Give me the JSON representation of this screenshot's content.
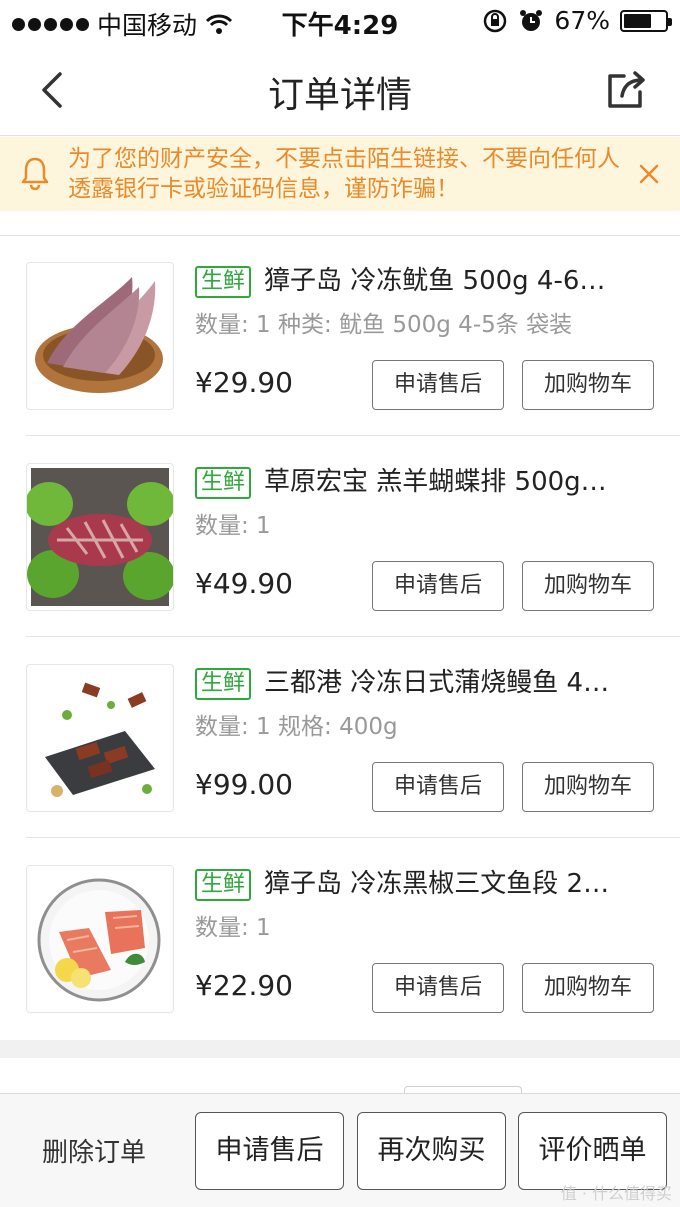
{
  "status_bar": {
    "carrier": "中国移动",
    "time": "下午4:29",
    "battery_text": "67%",
    "battery_level": 0.67
  },
  "nav": {
    "title": "订单详情",
    "back_icon": "chevron-left-icon",
    "share_icon": "share-icon"
  },
  "notice": {
    "text": "为了您的财产安全，不要点击陌生链接、不要向任何人透露银行卡或验证码信息，谨防诈骗！",
    "icon": "bell-icon",
    "close_icon": "close-icon",
    "color": "#e98a2b"
  },
  "items": [
    {
      "tag": "生鲜",
      "title": "獐子岛 冷冻鱿鱼 500g 4-6…",
      "spec": "数量: 1 种类: 鱿鱼 500g 4-5条 袋装",
      "price": "¥29.90",
      "after_sale": "申请售后",
      "add_cart": "加购物车"
    },
    {
      "tag": "生鲜",
      "title": "草原宏宝 羔羊蝴蝶排 500g…",
      "spec": "数量: 1",
      "price": "¥49.90",
      "after_sale": "申请售后",
      "add_cart": "加购物车"
    },
    {
      "tag": "生鲜",
      "title": "三都港 冷冻日式蒲烧鳗鱼 4…",
      "spec": "数量: 1 规格: 400g",
      "price": "¥99.00",
      "after_sale": "申请售后",
      "add_cart": "加购物车"
    },
    {
      "tag": "生鲜",
      "title": "獐子岛 冷冻黑椒三文鱼段 2…",
      "spec": "数量: 1",
      "price": "¥22.90",
      "after_sale": "申请售后",
      "add_cart": "加购物车"
    }
  ],
  "bottom_bar": {
    "delete": "删除订单",
    "after_sale": "申请售后",
    "rebuy": "再次购买",
    "review": "评价晒单"
  },
  "watermark": "值 · 什么值得买",
  "colors": {
    "fresh_tag": "#2fa83c",
    "notice_bg": "#fdf6dd"
  }
}
